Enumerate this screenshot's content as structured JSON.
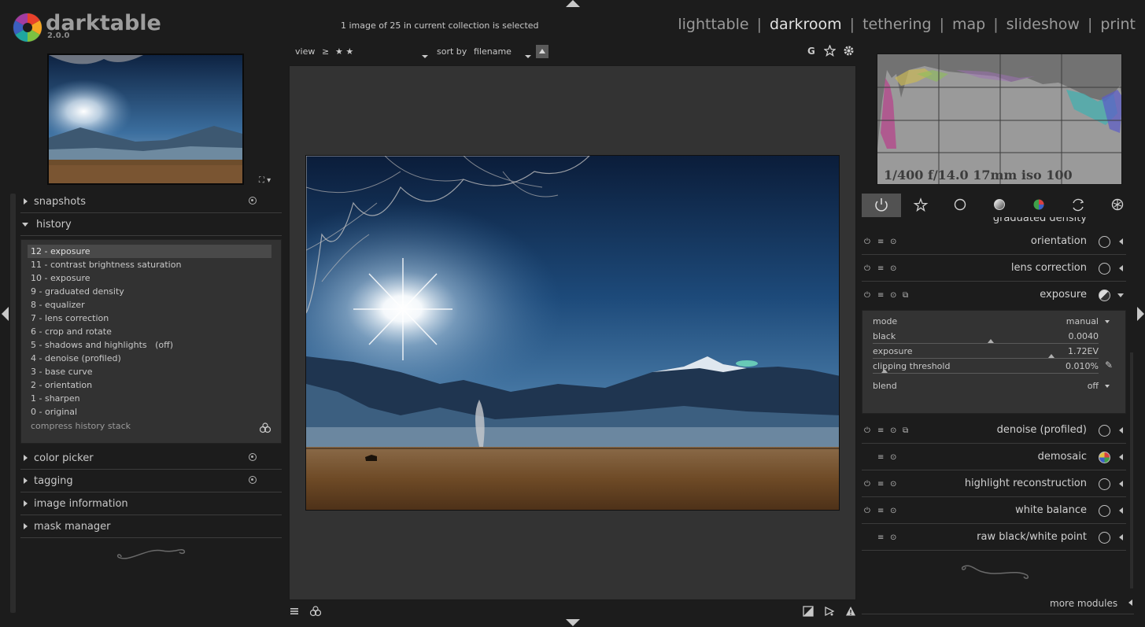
{
  "app": {
    "name": "darktable",
    "version": "2.0.0"
  },
  "header": {
    "collection_status": "1 image of 25 in current collection is selected",
    "views": [
      "lighttable",
      "darkroom",
      "tethering",
      "map",
      "slideshow",
      "print"
    ],
    "active_view": "darkroom",
    "separator": "|"
  },
  "filter_bar": {
    "view_label": "view",
    "rating_op": "≥",
    "rating_stars": "★ ★",
    "sort_label": "sort by",
    "sort_value": "filename",
    "grouping_label": "G"
  },
  "left_panel": {
    "modules": {
      "snapshots": "snapshots",
      "history": "history",
      "color_picker": "color picker",
      "tagging": "tagging",
      "image_information": "image information",
      "mask_manager": "mask manager"
    },
    "history_items": [
      "12 - exposure",
      "11 - contrast brightness saturation",
      "10 - exposure",
      "9 - graduated density",
      "8 - equalizer",
      "7 - lens correction",
      "6 - crop and rotate",
      "5 - shadows and highlights   (off)",
      "4 - denoise (profiled)",
      "3 - base curve",
      "2 - orientation",
      "1 - sharpen",
      "0 - original"
    ],
    "compress_label": "compress history stack"
  },
  "histogram": {
    "exif": "1/400 f/14.0 17mm iso 100"
  },
  "right_panel": {
    "partial_module": "graduated density",
    "modules": [
      {
        "name": "orientation",
        "icon": "orientation-icon"
      },
      {
        "name": "lens correction",
        "icon": "lens-icon"
      },
      {
        "name": "exposure",
        "icon": "exposure-icon"
      },
      {
        "name": "denoise (profiled)",
        "icon": "circle-icon"
      },
      {
        "name": "demosaic",
        "icon": "demosaic-icon"
      },
      {
        "name": "highlight reconstruction",
        "icon": "highlight-icon"
      },
      {
        "name": "white balance",
        "icon": "white-balance-icon"
      },
      {
        "name": "raw black/white point",
        "icon": "circle-icon"
      }
    ],
    "exposure_params": {
      "mode_label": "mode",
      "mode_value": "manual",
      "black_label": "black",
      "black_value": "0.0040",
      "exposure_label": "exposure",
      "exposure_value": "1.72EV",
      "clipping_label": "clipping threshold",
      "clipping_value": "0.010%",
      "blend_label": "blend",
      "blend_value": "off"
    },
    "more_modules": "more modules"
  }
}
